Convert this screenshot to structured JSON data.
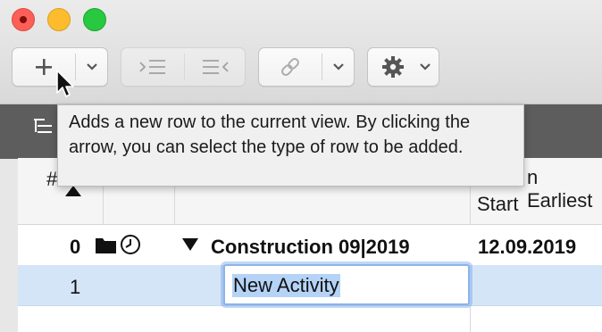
{
  "window": {
    "close_icon": "close-icon",
    "minimize_icon": "minimize-icon",
    "maximize_icon": "maximize-icon"
  },
  "toolbar": {
    "add_row_icon": "plus-icon",
    "add_row_menu_icon": "chevron-down-icon",
    "indent_icon": "indent-icon",
    "outdent_icon": "outdent-icon",
    "link_icon": "link-icon",
    "link_menu_icon": "chevron-down-icon",
    "settings_icon": "gear-icon",
    "settings_menu_icon": "chevron-down-icon"
  },
  "tooltip": {
    "text": "Adds a new row to the current view. By clicking the arrow, you can select the type of row to be added."
  },
  "table": {
    "headers": {
      "number": "#",
      "earliest_start_line1": "Earliest",
      "earliest_start_line1_prefix": "n",
      "earliest_start_line2": "Start"
    },
    "rows": [
      {
        "number": "0",
        "icons": [
          "folder-icon",
          "clock-icon"
        ],
        "name": "Construction 09|2019",
        "start": "12.09.2019",
        "expanded": true
      },
      {
        "number": "1",
        "name": "New Activity",
        "start": ""
      }
    ]
  },
  "colors": {
    "selection_row": "#d5e5f8",
    "sidebar_strip": "#5d5d5d",
    "edit_focus": "#8ab4ea"
  }
}
